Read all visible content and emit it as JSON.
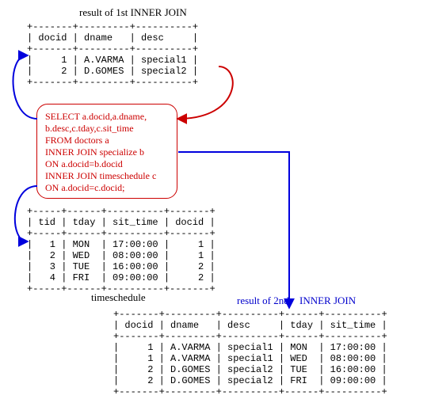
{
  "labels": {
    "first_join_title": "result of 1st INNER JOIN",
    "timeschedule_title": "timeschedule",
    "second_join_prefix": "result of 2nd",
    "second_join_suffix": "INNER JOIN"
  },
  "sql": {
    "l1": "SELECT a.docid,a.dname,",
    "l2": "b.desc,c.tday,c.sit_time",
    "l3": "FROM doctors a",
    "l4": "INNER JOIN specialize b",
    "l5": "ON a.docid=b.docid",
    "l6": "INNER JOIN timeschedule c",
    "l7": "ON a.docid=c.docid;"
  },
  "table_first": {
    "headers": [
      "docid",
      "dname",
      "desc"
    ],
    "rows": [
      [
        "1",
        "A.VARMA",
        "special1"
      ],
      [
        "2",
        "D.GOMES",
        "special2"
      ]
    ]
  },
  "table_timeschedule": {
    "headers": [
      "tid",
      "tday",
      "sit_time",
      "docid"
    ],
    "rows": [
      [
        "1",
        "MON",
        "17:00:00",
        "1"
      ],
      [
        "2",
        "WED",
        "08:00:00",
        "1"
      ],
      [
        "3",
        "TUE",
        "16:00:00",
        "2"
      ],
      [
        "4",
        "FRI",
        "09:00:00",
        "2"
      ]
    ]
  },
  "table_second": {
    "headers": [
      "docid",
      "dname",
      "desc",
      "tday",
      "sit_time"
    ],
    "rows": [
      [
        "1",
        "A.VARMA",
        "special1",
        "MON",
        "17:00:00"
      ],
      [
        "1",
        "A.VARMA",
        "special1",
        "WED",
        "08:00:00"
      ],
      [
        "2",
        "D.GOMES",
        "special2",
        "TUE",
        "16:00:00"
      ],
      [
        "2",
        "D.GOMES",
        "special2",
        "FRI",
        "09:00:00"
      ]
    ]
  },
  "chart_data": [
    {
      "type": "table",
      "title": "result of 1st INNER JOIN",
      "headers": [
        "docid",
        "dname",
        "desc"
      ],
      "rows": [
        [
          1,
          "A.VARMA",
          "special1"
        ],
        [
          2,
          "D.GOMES",
          "special2"
        ]
      ]
    },
    {
      "type": "table",
      "title": "timeschedule",
      "headers": [
        "tid",
        "tday",
        "sit_time",
        "docid"
      ],
      "rows": [
        [
          1,
          "MON",
          "17:00:00",
          1
        ],
        [
          2,
          "WED",
          "08:00:00",
          1
        ],
        [
          3,
          "TUE",
          "16:00:00",
          2
        ],
        [
          4,
          "FRI",
          "09:00:00",
          2
        ]
      ]
    },
    {
      "type": "table",
      "title": "result of 2nd INNER JOIN",
      "headers": [
        "docid",
        "dname",
        "desc",
        "tday",
        "sit_time"
      ],
      "rows": [
        [
          1,
          "A.VARMA",
          "special1",
          "MON",
          "17:00:00"
        ],
        [
          1,
          "A.VARMA",
          "special1",
          "WED",
          "08:00:00"
        ],
        [
          2,
          "D.GOMES",
          "special2",
          "TUE",
          "16:00:00"
        ],
        [
          2,
          "D.GOMES",
          "special2",
          "FRI",
          "09:00:00"
        ]
      ]
    }
  ]
}
